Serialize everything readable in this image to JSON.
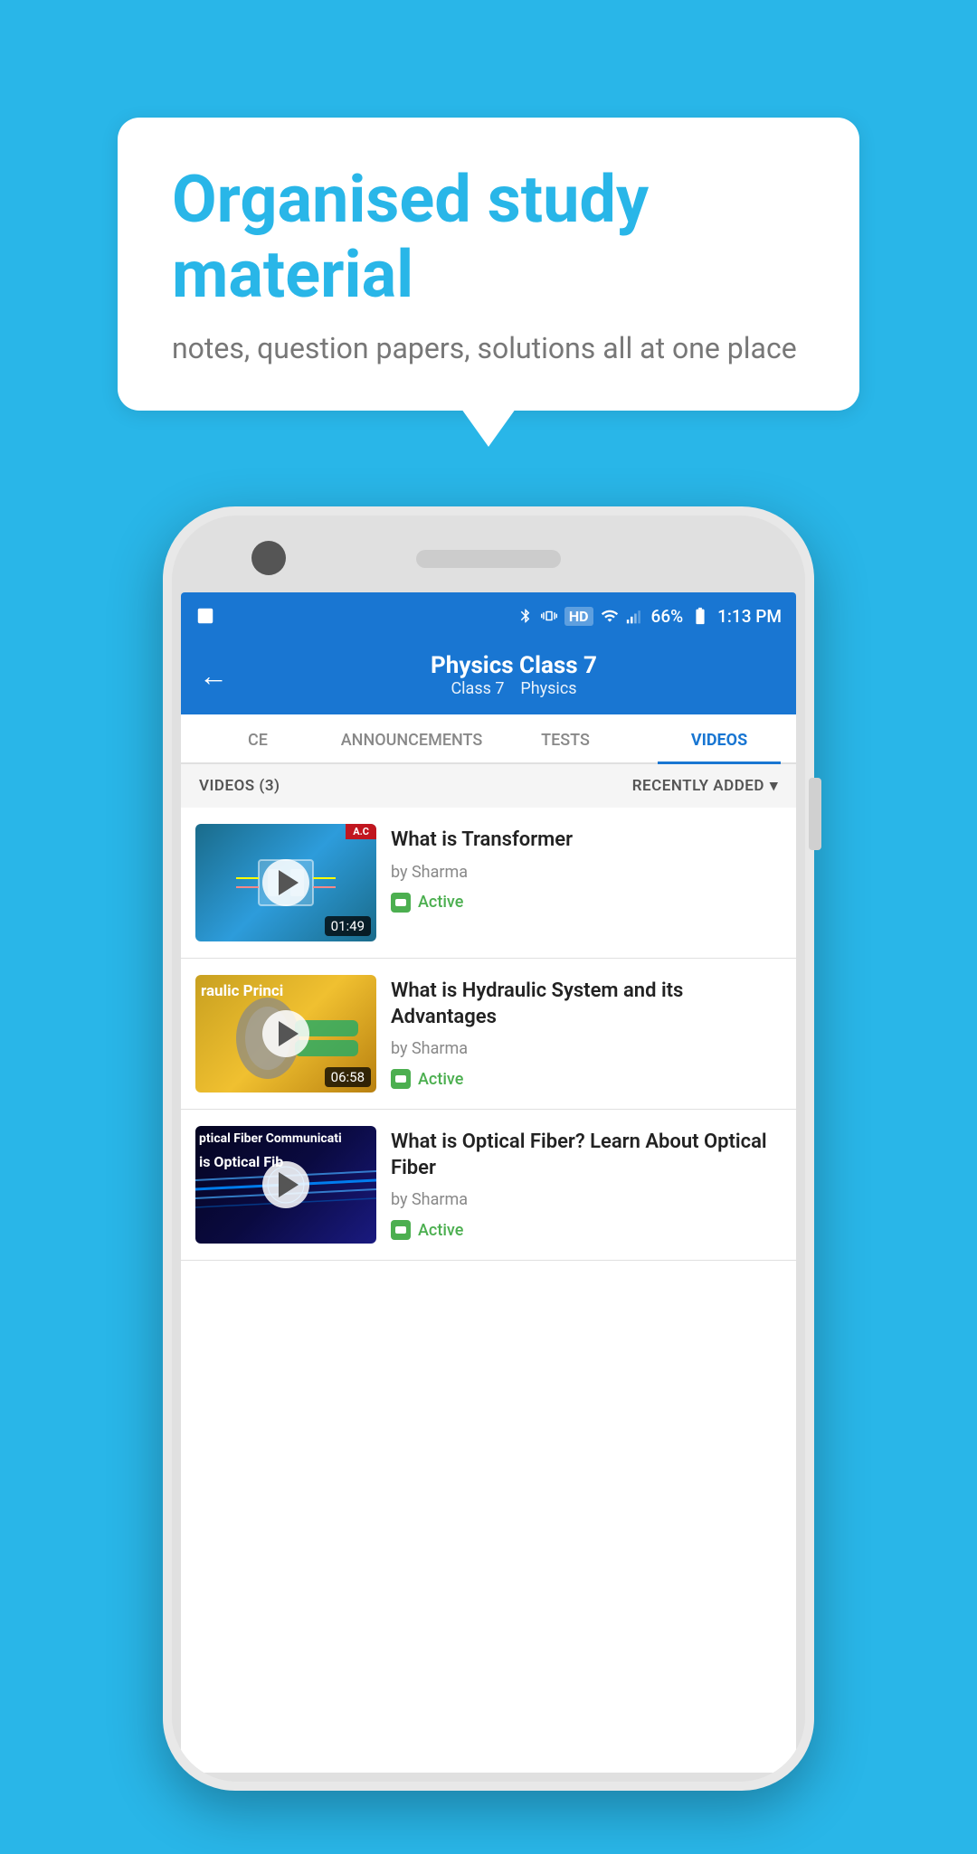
{
  "background_color": "#29b6e8",
  "speech_bubble": {
    "heading": "Organised study material",
    "subtext": "notes, question papers, solutions all at one place"
  },
  "phone": {
    "status_bar": {
      "battery": "66%",
      "time": "1:13 PM"
    },
    "header": {
      "title": "Physics Class 7",
      "subtitle_class": "Class 7",
      "subtitle_subject": "Physics",
      "back_label": "←"
    },
    "tabs": [
      {
        "id": "ce",
        "label": "CE",
        "active": false
      },
      {
        "id": "announcements",
        "label": "ANNOUNCEMENTS",
        "active": false
      },
      {
        "id": "tests",
        "label": "TESTS",
        "active": false
      },
      {
        "id": "videos",
        "label": "VIDEOS",
        "active": true
      }
    ],
    "filter_bar": {
      "count_label": "VIDEOS (3)",
      "sort_label": "RECENTLY ADDED"
    },
    "videos": [
      {
        "id": 1,
        "title": "What is  Transformer",
        "author": "by Sharma",
        "status": "Active",
        "duration": "01:49",
        "thumb_type": "transformer",
        "has_ac_label": true
      },
      {
        "id": 2,
        "title": "What is Hydraulic System and its Advantages",
        "author": "by Sharma",
        "status": "Active",
        "duration": "06:58",
        "thumb_type": "hydraulic",
        "thumb_text": "raulic Princi"
      },
      {
        "id": 3,
        "title": "What is Optical Fiber? Learn About Optical Fiber",
        "author": "by Sharma",
        "status": "Active",
        "duration": "",
        "thumb_type": "optical",
        "thumb_text1": "ptical Fiber Communicati",
        "thumb_text2": " is Optical Fib"
      }
    ]
  }
}
